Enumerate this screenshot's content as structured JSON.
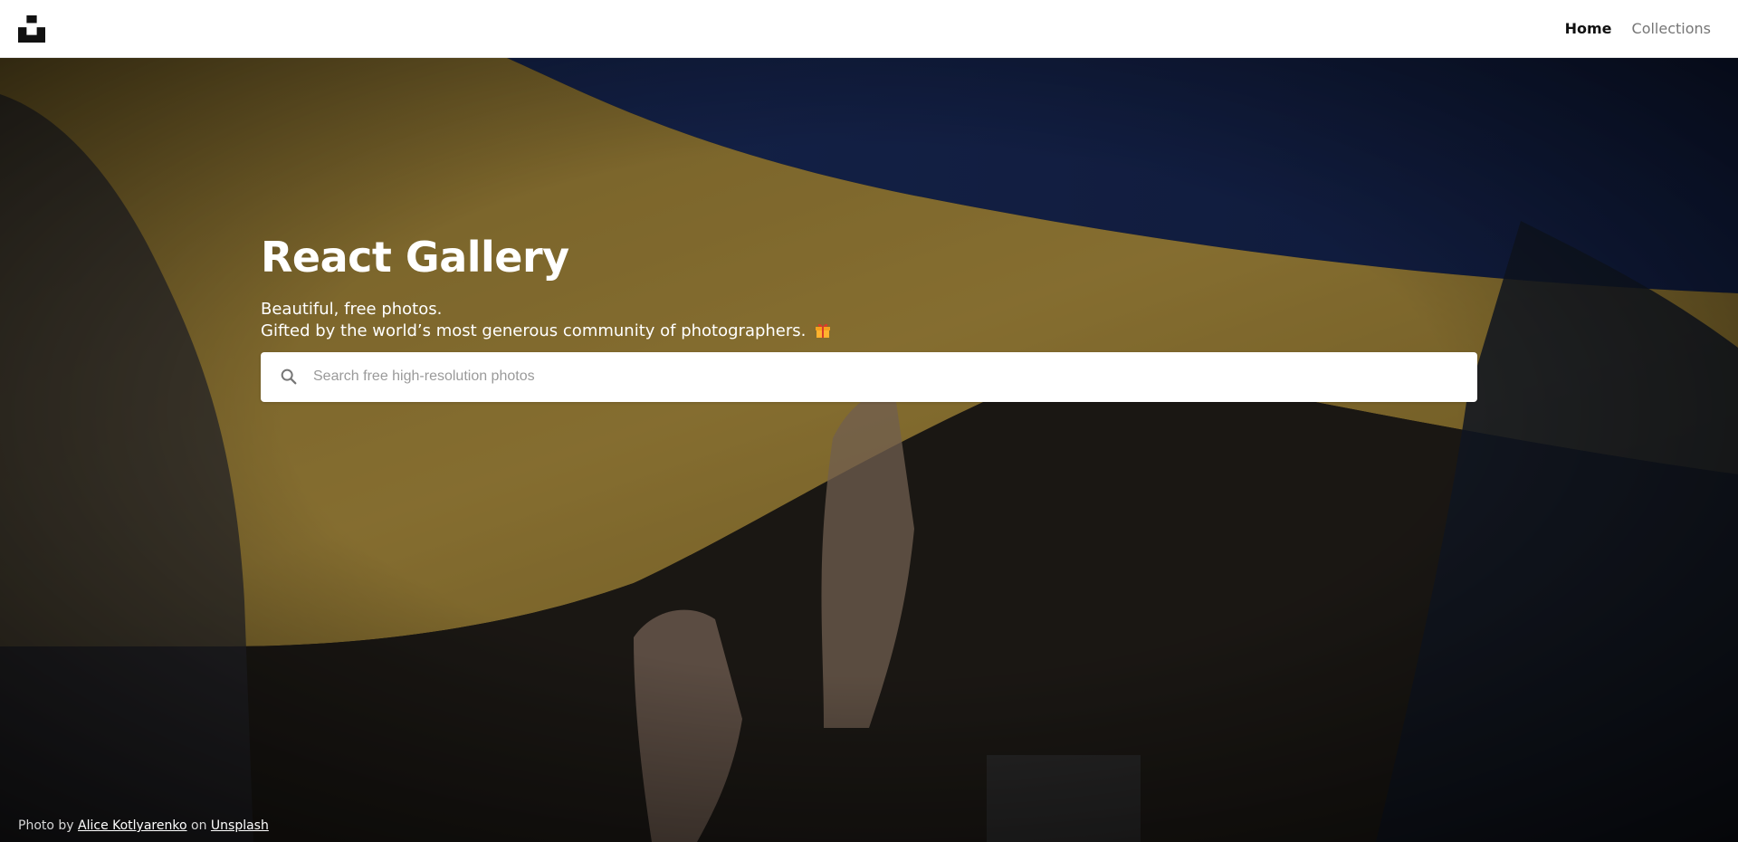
{
  "nav": {
    "logo_icon": "unsplash-logo-icon",
    "links": [
      {
        "label": "Home",
        "active": true
      },
      {
        "label": "Collections",
        "active": false
      }
    ]
  },
  "hero": {
    "title": "React Gallery",
    "subtitle_line1": "Beautiful, free photos.",
    "subtitle_line2": "Gifted by the world’s most generous community of photographers.",
    "subtitle_emoji_icon": "gift-icon"
  },
  "search": {
    "icon": "search-icon",
    "placeholder": "Search free high-resolution photos",
    "value": ""
  },
  "credit": {
    "prefix": "Photo by",
    "author": "Alice Kotlyarenko",
    "middle": "on",
    "site": "Unsplash"
  },
  "colors": {
    "flag_yellow": "#d8b04a",
    "flag_blue": "#1d3c99",
    "nav_active": "#111111",
    "nav_inactive": "#767676"
  }
}
